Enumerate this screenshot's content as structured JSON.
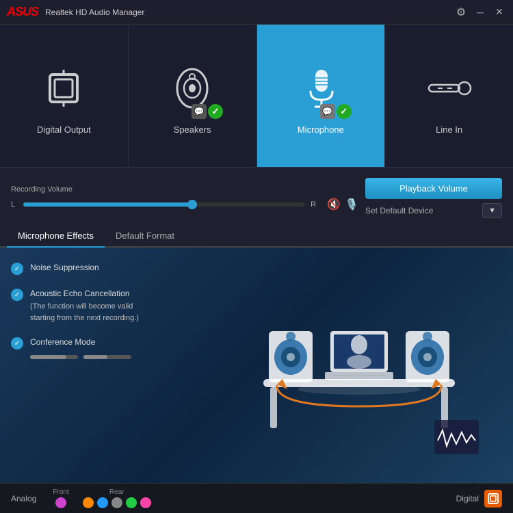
{
  "app": {
    "title": "Realtek HD Audio Manager",
    "logo": "ASUS"
  },
  "titlebar": {
    "settings_label": "⚙",
    "minimize_label": "─",
    "close_label": "✕"
  },
  "devices": [
    {
      "id": "digital-output",
      "label": "Digital Output",
      "active": false,
      "has_badges": false
    },
    {
      "id": "speakers",
      "label": "Speakers",
      "active": false,
      "has_badges": true
    },
    {
      "id": "microphone",
      "label": "Microphone",
      "active": true,
      "has_badges": true
    },
    {
      "id": "line-in",
      "label": "Line In",
      "active": false,
      "has_badges": false
    }
  ],
  "recording": {
    "volume_label": "Recording Volume",
    "slider_left": "L",
    "slider_right": "R",
    "slider_value": 60
  },
  "playback": {
    "button_label": "Playback Volume",
    "default_device_label": "Set Default Device",
    "dropdown_arrow": "▼"
  },
  "tabs": [
    {
      "id": "microphone-effects",
      "label": "Microphone Effects",
      "active": true
    },
    {
      "id": "default-format",
      "label": "Default Format",
      "active": false
    }
  ],
  "effects": [
    {
      "id": "noise-suppression",
      "label": "Noise Suppression",
      "checked": true,
      "sublabel": ""
    },
    {
      "id": "acoustic-echo",
      "label": "Acoustic Echo Cancellation",
      "checked": true,
      "sublabel": "(The function will become valid\nstarting from the next recording.)"
    },
    {
      "id": "conference-mode",
      "label": "Conference Mode",
      "checked": true,
      "sublabel": ""
    }
  ],
  "status_bar": {
    "analog_label": "Analog",
    "front_label": "Front",
    "rear_label": "Rear",
    "digital_label": "Digital",
    "front_dots": [
      {
        "color": "#cc44cc"
      }
    ],
    "rear_dots": [
      {
        "color": "#ff8800"
      },
      {
        "color": "#2299ff"
      },
      {
        "color": "#888888"
      },
      {
        "color": "#22cc44"
      },
      {
        "color": "#ff44aa"
      }
    ]
  }
}
